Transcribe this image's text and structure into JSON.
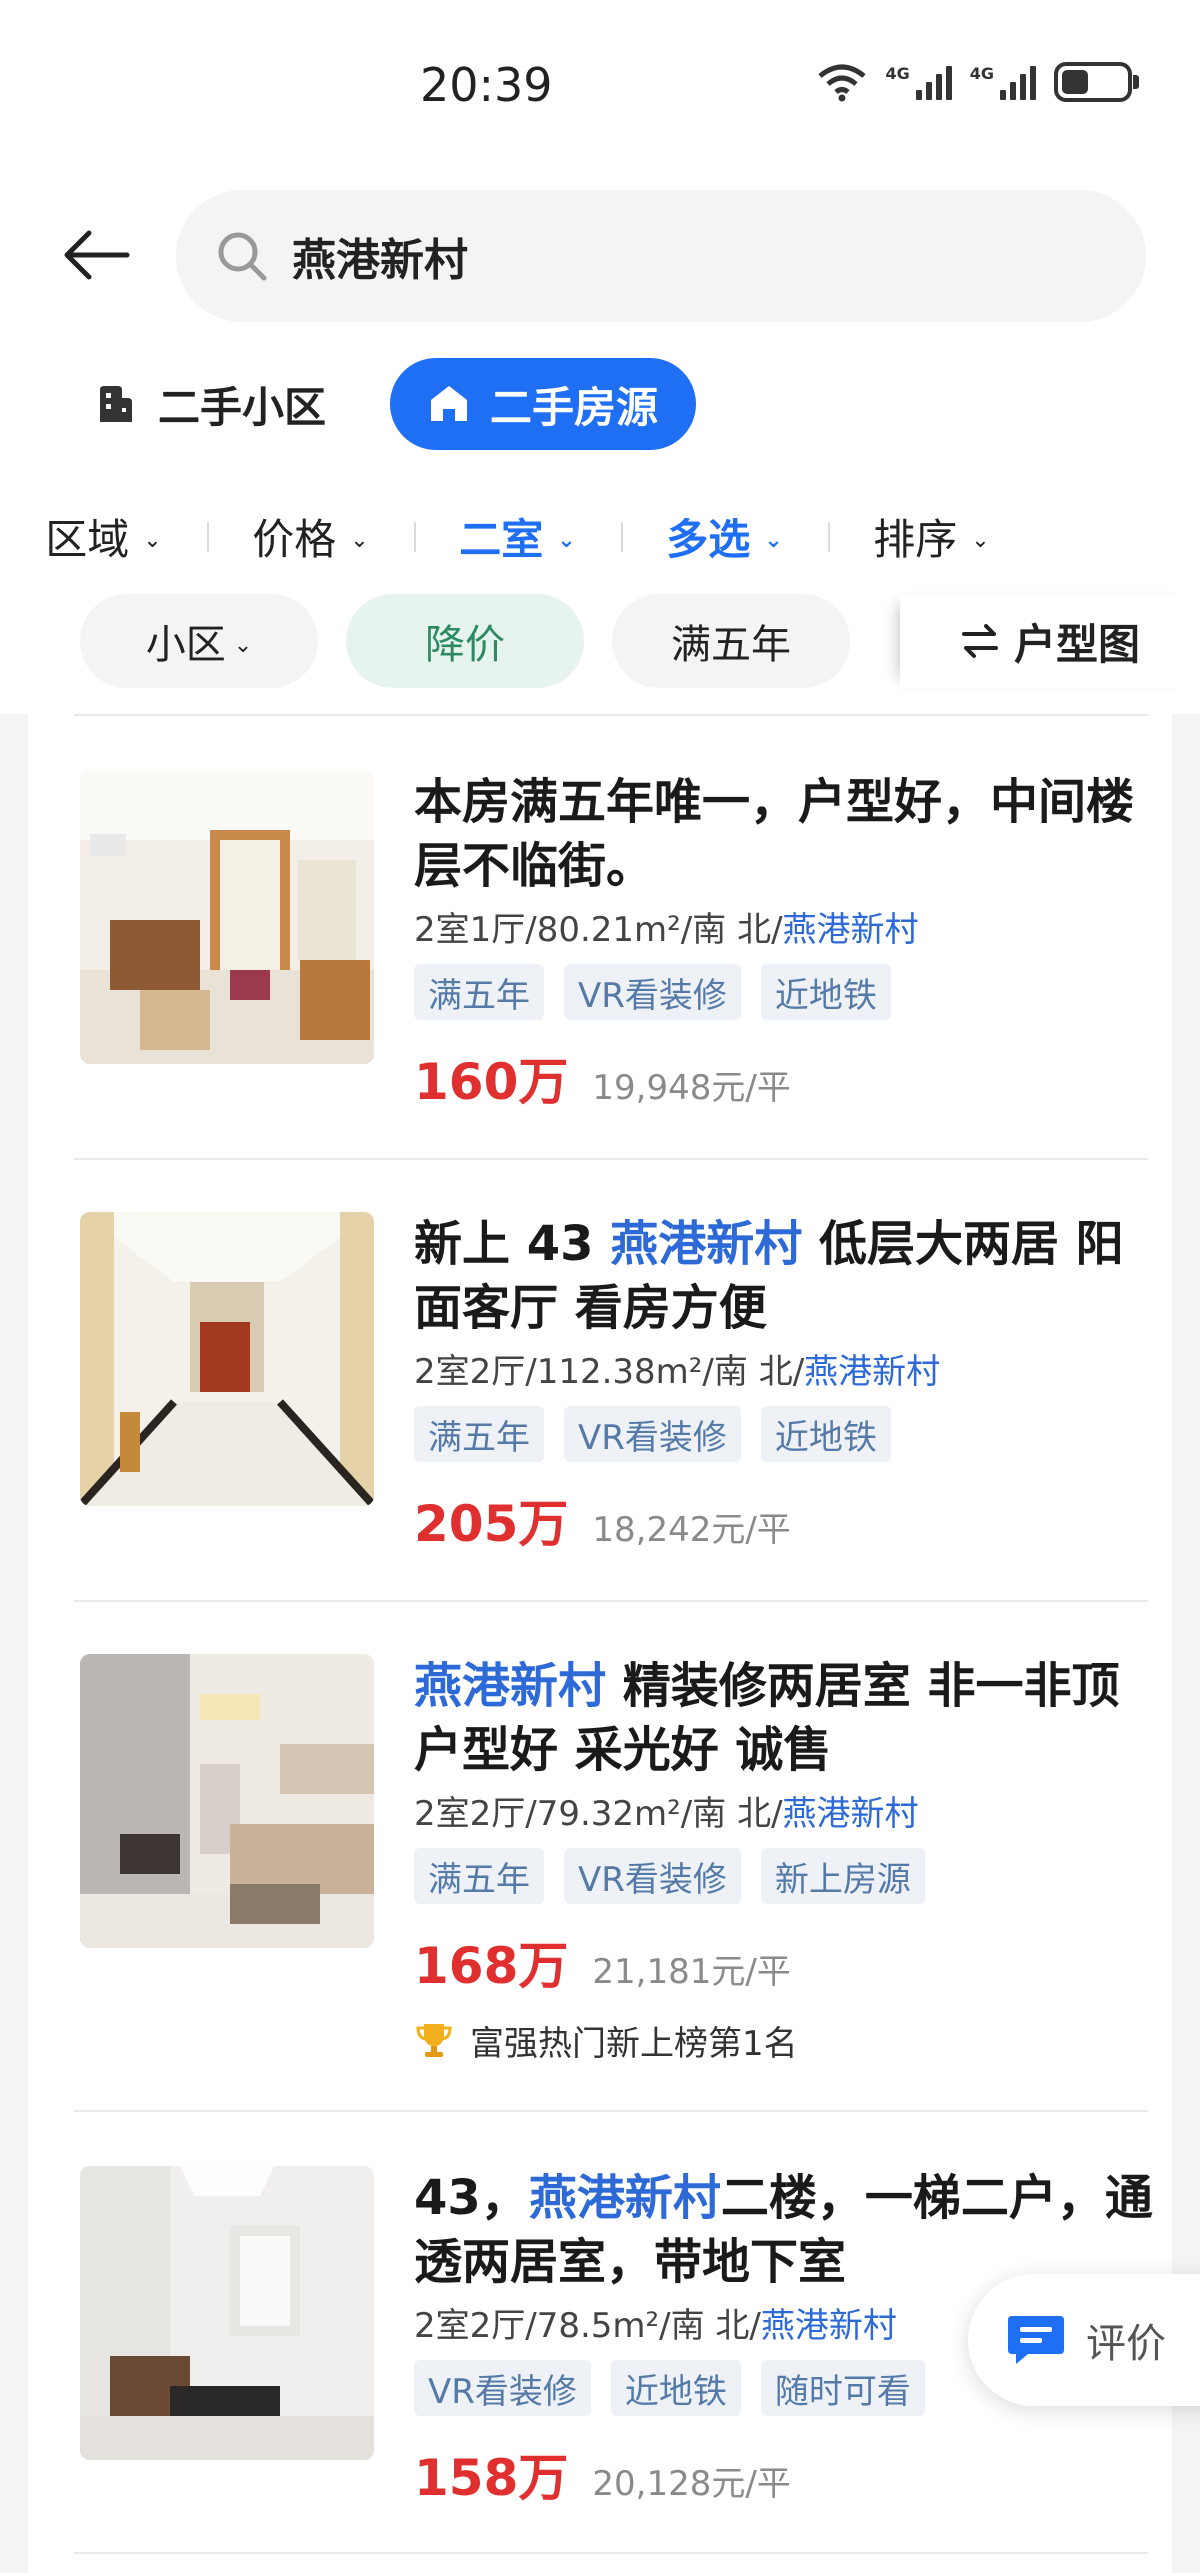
{
  "status_bar": {
    "time": "20:39",
    "signal1_label": "4G",
    "signal2_label": "4G"
  },
  "search": {
    "query": "燕港新村"
  },
  "category_tabs": {
    "community": "二手小区",
    "listings": "二手房源"
  },
  "filters": [
    {
      "label": "区域",
      "active": false
    },
    {
      "label": "价格",
      "active": false
    },
    {
      "label": "二室",
      "active": true
    },
    {
      "label": "多选",
      "active": true
    },
    {
      "label": "排序",
      "active": false
    }
  ],
  "quick_filters": {
    "community": "小区",
    "discount": "降价",
    "five_years": "满五年",
    "layout_label": "户型图"
  },
  "listings": [
    {
      "title_pre": "本房满五年唯一，户型好，中间楼层不临街。",
      "title_hl": "",
      "title_post": "",
      "specs": "2室1厅/80.21m²/南 北/",
      "community": "燕港新村",
      "tags": [
        "满五年",
        "VR看装修",
        "近地铁"
      ],
      "price": "160万",
      "unit_price": "19,948元/平"
    },
    {
      "title_pre": "新上 43 ",
      "title_hl": "燕港新村",
      "title_post": " 低层大两居 阳面客厅 看房方便",
      "specs": "2室2厅/112.38m²/南 北/",
      "community": "燕港新村",
      "tags": [
        "满五年",
        "VR看装修",
        "近地铁"
      ],
      "price": "205万",
      "unit_price": "18,242元/平"
    },
    {
      "title_pre": "",
      "title_hl": "燕港新村",
      "title_post": " 精装修两居室 非一非顶 户型好 采光好 诚售",
      "specs": "2室2厅/79.32m²/南 北/",
      "community": "燕港新村",
      "tags": [
        "满五年",
        "VR看装修",
        "新上房源"
      ],
      "price": "168万",
      "unit_price": "21,181元/平",
      "rank": "富强热门新上榜第1名"
    },
    {
      "title_pre": "43，",
      "title_hl": "燕港新村",
      "title_post": "二楼，一梯二户，通透两居室，带地下室",
      "specs": "2室2厅/78.5m²/南 北/",
      "community": "燕港新村",
      "tags": [
        "VR看装修",
        "近地铁",
        "随时可看"
      ],
      "price": "158万",
      "unit_price": "20,128元/平"
    }
  ],
  "floating": {
    "review_label": "评价"
  },
  "colors": {
    "accent": "#1f6ff5",
    "price": "#e02f2f",
    "link": "#2d6ad8",
    "discount_chip_text": "#2d8a63"
  }
}
